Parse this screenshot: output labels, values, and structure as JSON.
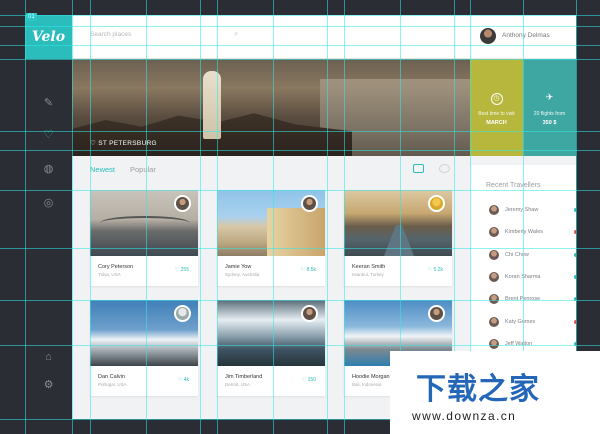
{
  "app": {
    "logo": "Velo",
    "tag": "01"
  },
  "search": {
    "placeholder": "Search places"
  },
  "user": {
    "name": "Anthony Delmas"
  },
  "hero": {
    "location": "ST PETERSBURG"
  },
  "tiles": [
    {
      "line1": "Best time to visit",
      "line2": "MARCH",
      "icon": "clock-icon",
      "color": "#b7b73e"
    },
    {
      "line1": "20 flights from",
      "line2": "350 $",
      "icon": "plane-icon",
      "color": "#3fa7a2"
    }
  ],
  "tabs": {
    "newest": "Newest",
    "popular": "Popular"
  },
  "cards": [
    {
      "name": "Cory Peterson",
      "sub": "Tulsa, USA",
      "likes": "255"
    },
    {
      "name": "Jamie Yow",
      "sub": "Sydney, Australia",
      "likes": "8.5k"
    },
    {
      "name": "Keeran Smith",
      "sub": "Istanbul, Turkey",
      "likes": "5.2k"
    },
    {
      "name": "Dan Calvin",
      "sub": "Portugal, USA",
      "likes": "4k"
    },
    {
      "name": "Jim Timberland",
      "sub": "Detroit, USA",
      "likes": "150"
    },
    {
      "name": "Hoodie Morgan",
      "sub": "Bali, Indonesia",
      "likes": ""
    }
  ],
  "panel": {
    "title": "Recent Travellers",
    "travellers": [
      {
        "name": "Jeremy Shaw",
        "dot": "#2bbcbc"
      },
      {
        "name": "Kimberly Wales",
        "dot": "#e0504b"
      },
      {
        "name": "Chi Chow",
        "dot": "#2bbcbc"
      },
      {
        "name": "Koran Sharma",
        "dot": "#2bbcbc"
      },
      {
        "name": "Brent Penrose",
        "dot": "#2bbcbc"
      },
      {
        "name": "Katy Gomes",
        "dot": "#e0504b"
      },
      {
        "name": "Jeff Walton",
        "dot": "#2bbcbc"
      }
    ]
  },
  "watermark": {
    "brand": "下载之家",
    "url": "www.downza.cn"
  }
}
